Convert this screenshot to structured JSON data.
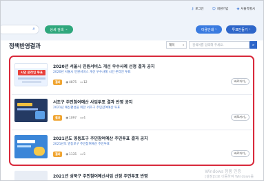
{
  "header": {
    "utility_links": [
      {
        "icon": "login-icon",
        "glyph": "⚷",
        "label": "로그인"
      },
      {
        "icon": "join-icon",
        "glyph": "☺",
        "label": "회원가입"
      },
      {
        "icon": "seoul-icon",
        "glyph": "◈",
        "label": "서울특별시"
      }
    ],
    "detail_search_label": "상세 검색",
    "detail_search_glyph": "⌄",
    "guide_label": "이용안내",
    "create_vote_label": "투표만들기",
    "chevron_glyph": "›"
  },
  "page": {
    "title": "정책반영결과"
  },
  "filter": {
    "select_value": "제목",
    "select_glyph": "▾",
    "input_placeholder": "검색어를 입력해 주세요.",
    "search_glyph": "⌕"
  },
  "results": [
    {
      "thumb_text": "시민 온라인 투표",
      "title": "2020년 서울시 민원서비스 개선 우수사례 선정 결과 공지",
      "subtitle": "2020년 서울시 민원서비스 개선 우수사례 시민 온라인 투표",
      "status": "결과",
      "views": "4875",
      "comments": "12",
      "more_label": "바로가기"
    },
    {
      "thumb_text": "",
      "title": "서초구 주민참여예산 사업투표 결과 반영 공지",
      "subtitle": "2021년 예산편성을 위한 서초구 주민참여예산 투표",
      "status": "결과",
      "views": "1097",
      "comments": "4",
      "more_label": "바로가기"
    },
    {
      "thumb_text": "",
      "title": "2021년도 영등포구 주민참여예산 주민투표 결과 공지",
      "subtitle": "2021년도 영등포구 주민참여예산 주민투표",
      "status": "결과",
      "views": "1135",
      "comments": "5",
      "more_label": "바로가기"
    }
  ],
  "partial_result": {
    "title": "2021년 성북구 주민참여예산사업 선정 주민투표 반영"
  },
  "meta_glyphs": {
    "views_glyph": "◉",
    "comments_glyph": "▭",
    "more_glyph": "›"
  },
  "os_watermark": {
    "line1": "Windows 정품 인증",
    "line2": "[설정]으로 이동하여 Windows를"
  },
  "colors": {
    "accent_blue": "#2e66c9",
    "green": "#2fa77c",
    "highlight_red": "#d8283a",
    "status_orange": "#f0a532"
  }
}
